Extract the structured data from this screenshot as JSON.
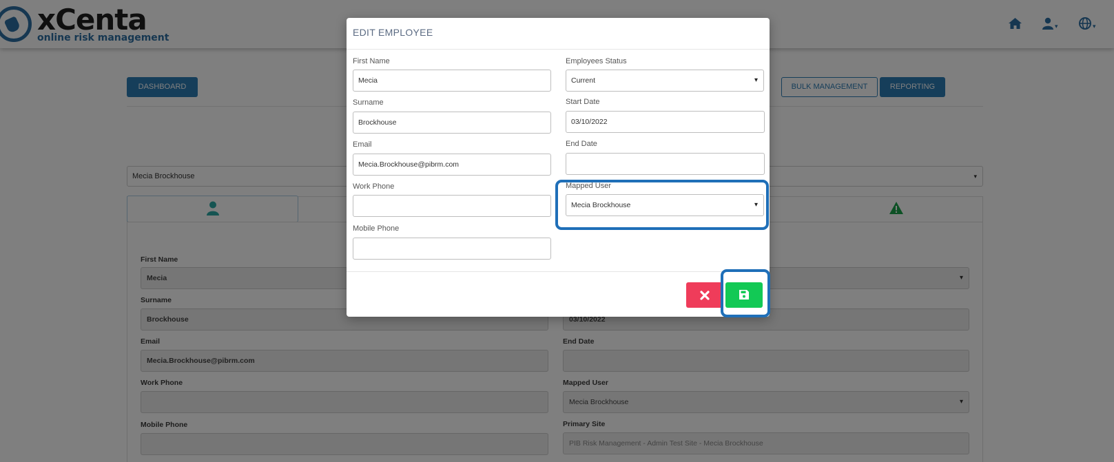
{
  "header": {
    "logo_name": "xCenta",
    "logo_tagline": "online risk management",
    "icons": [
      "home-icon",
      "user-icon",
      "globe-icon"
    ]
  },
  "toolbar": {
    "dashboard_label": "DASHBOARD",
    "bulk_management_label": "BULK MANAGEMENT",
    "reporting_label": "REPORTING"
  },
  "employee_selector": {
    "value": "Mecia Brockhouse"
  },
  "tabs": [
    "user-icon",
    "warning-icon"
  ],
  "details_form": {
    "first_name_label": "First Name",
    "first_name_value": "Mecia",
    "surname_label": "Surname",
    "surname_value": "Brockhouse",
    "email_label": "Email",
    "email_value": "Mecia.Brockhouse@pibrm.com",
    "work_phone_label": "Work Phone",
    "work_phone_value": "",
    "mobile_phone_label": "Mobile Phone",
    "mobile_phone_value": "",
    "start_date_value": "03/10/2022",
    "end_date_label": "End Date",
    "end_date_value": "",
    "mapped_user_label": "Mapped User",
    "mapped_user_value": "Mecia Brockhouse",
    "primary_site_label": "Primary Site",
    "primary_site_value": "PIB Risk Management - Admin Test Site - Mecia Brockhouse"
  },
  "modal": {
    "title": "EDIT EMPLOYEE",
    "first_name_label": "First Name",
    "first_name_value": "Mecia",
    "surname_label": "Surname",
    "surname_value": "Brockhouse",
    "email_label": "Email",
    "email_value": "Mecia.Brockhouse@pibrm.com",
    "work_phone_label": "Work Phone",
    "work_phone_value": "",
    "mobile_phone_label": "Mobile Phone",
    "mobile_phone_value": "",
    "status_label": "Employees Status",
    "status_value": "Current",
    "start_date_label": "Start Date",
    "start_date_value": "03/10/2022",
    "end_date_label": "End Date",
    "end_date_value": "",
    "mapped_user_label": "Mapped User",
    "mapped_user_value": "Mecia Brockhouse",
    "cancel_icon": "close-icon",
    "save_icon": "save-icon"
  },
  "colors": {
    "brand_blue": "#2d7cb5",
    "cancel_red": "#ef3c5a",
    "save_green": "#12c955",
    "highlight_blue": "#1f6fb8"
  }
}
